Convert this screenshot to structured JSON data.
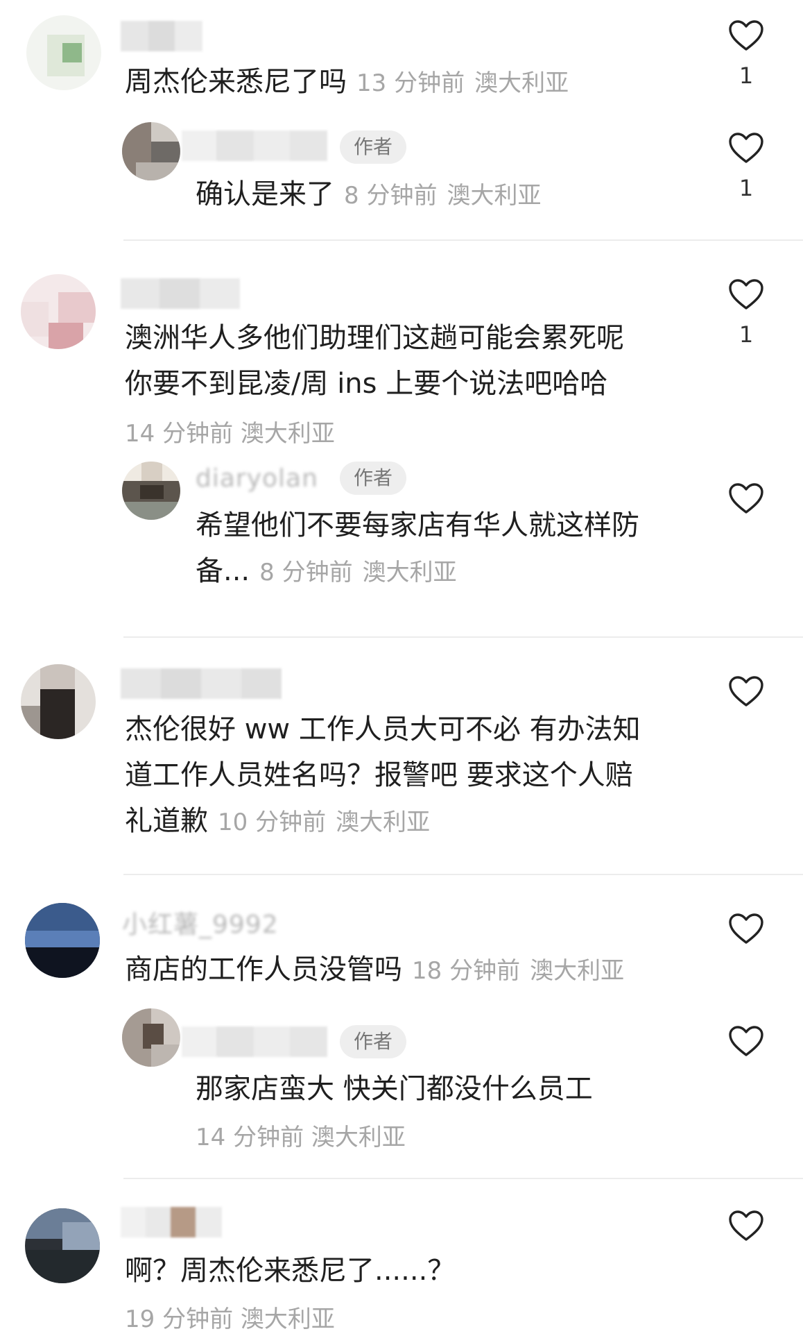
{
  "badge_author": "作者",
  "comments": [
    {
      "text": "周杰伦来悉尼了吗",
      "time": "13 分钟前",
      "location": "澳大利亚",
      "likes": "1",
      "reply": {
        "text": "确认是来了",
        "time": "8 分钟前",
        "location": "澳大利亚",
        "likes": "1"
      }
    },
    {
      "text_line1": "澳洲华人多他们助理们这趟可能会累死呢",
      "text_line2": "你要不到昆凌/周 ins 上要个说法吧哈哈",
      "time": "14 分钟前",
      "location": "澳大利亚",
      "likes": "1",
      "reply": {
        "username_partial": "diaryolan",
        "text_line1": "希望他们不要每家店有华人就这样防",
        "text_line2": "备...",
        "time": "8 分钟前",
        "location": "澳大利亚"
      }
    },
    {
      "text_line1": "杰伦很好 ww 工作人员大可不必 有办法知",
      "text_line2": "道工作人员姓名吗？报警吧 要求这个人赔",
      "text_line3": "礼道歉",
      "time": "10 分钟前",
      "location": "澳大利亚"
    },
    {
      "username_partial": "小红薯_9992",
      "text": "商店的工作人员没管吗",
      "time": "18 分钟前",
      "location": "澳大利亚",
      "reply": {
        "text": "那家店蛮大 快关门都没什么员工",
        "time": "14 分钟前",
        "location": "澳大利亚"
      }
    },
    {
      "text": "啊？周杰伦来悉尼了......？",
      "time": "19 分钟前",
      "location": "澳大利亚"
    }
  ],
  "icons": {
    "like": "heart-outline-icon"
  },
  "colors": {
    "meta_gray": "#a6a6a6",
    "badge_bg": "#eeeeee",
    "divider": "#ececec"
  }
}
